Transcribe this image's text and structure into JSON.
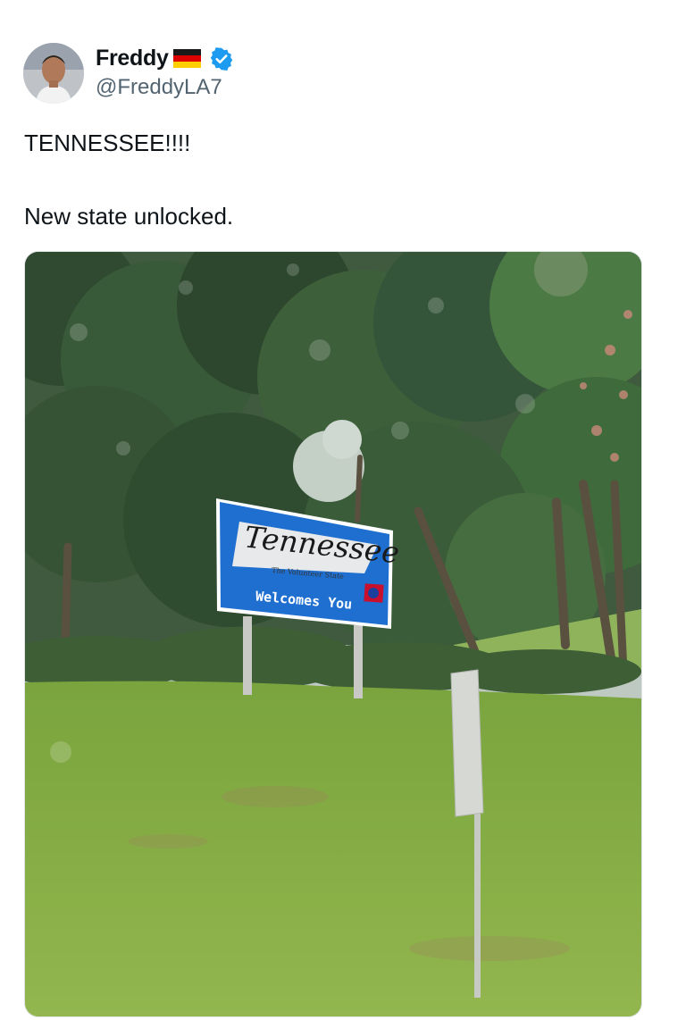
{
  "tweet": {
    "author": {
      "display_name": "Freddy",
      "flag_icon": "germany-flag-icon",
      "verified_icon": "verified-badge-icon",
      "verified_color": "#1d9bf0",
      "handle": "@FreddyLA7"
    },
    "text": "TENNESSEE!!!!\n\nNew state unlocked.",
    "media": {
      "sign": {
        "script": "Tennessee",
        "motto": "The Volunteer State",
        "greeting": "Welcomes You",
        "color": "#1f6fd0"
      }
    }
  }
}
